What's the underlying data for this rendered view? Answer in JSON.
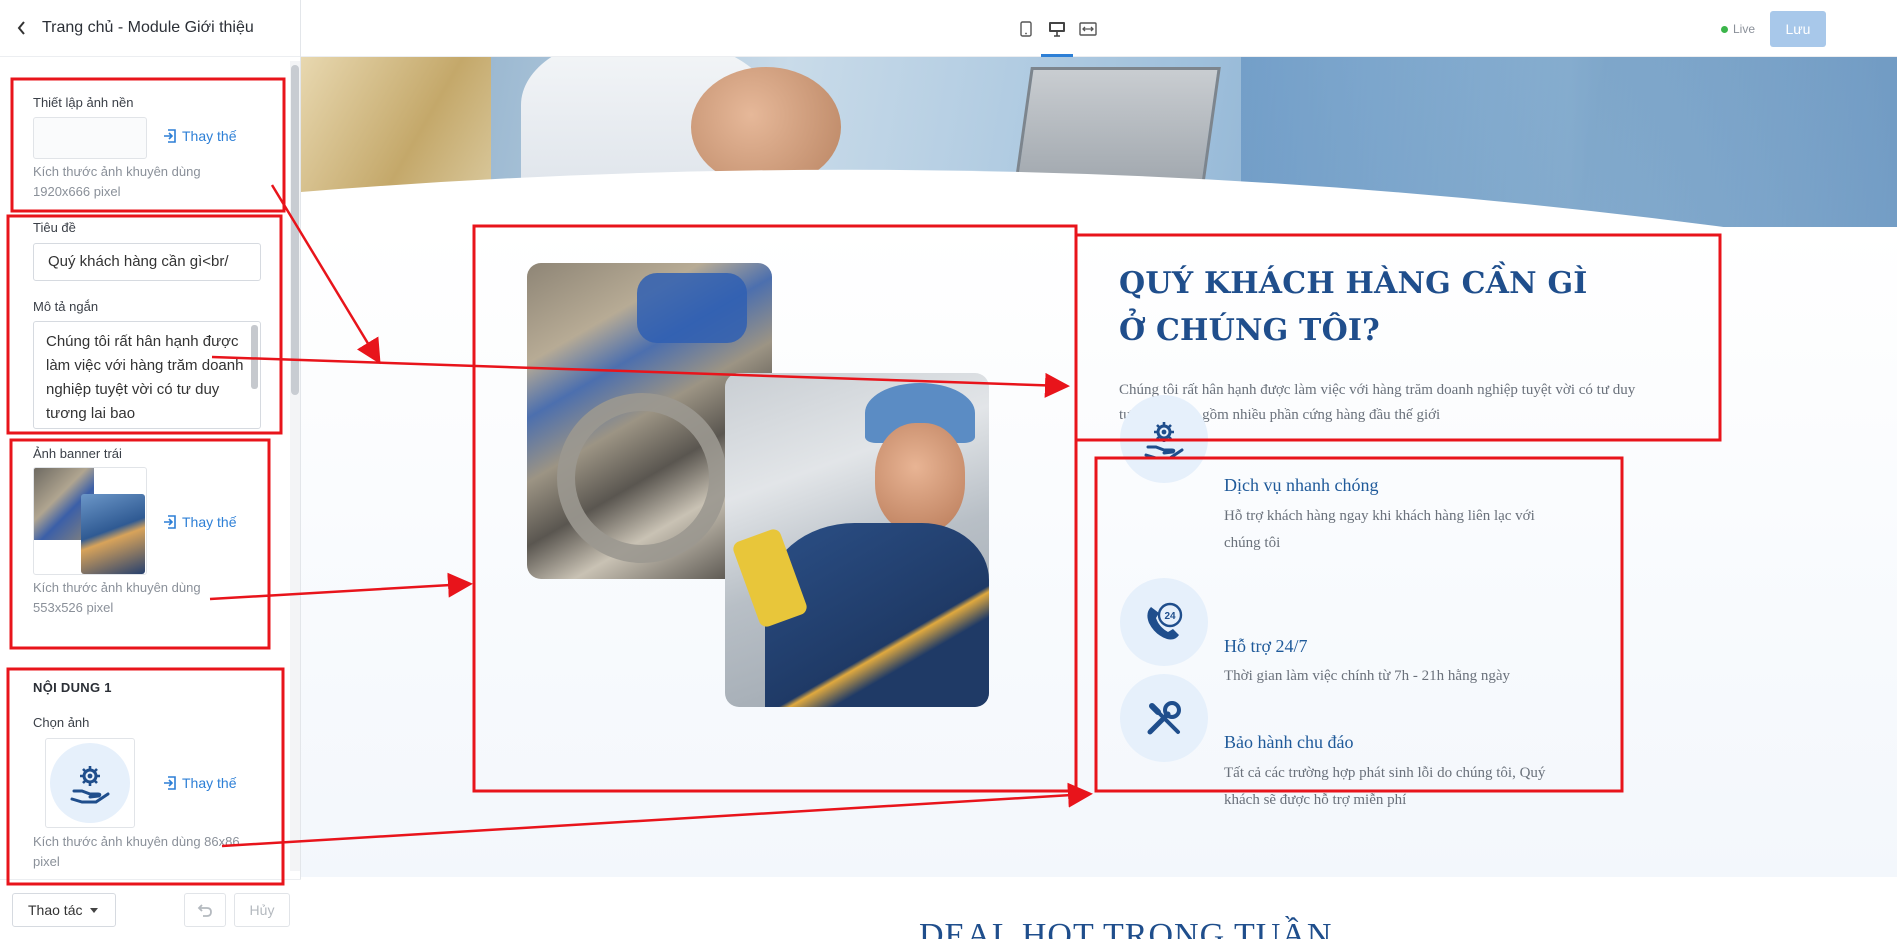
{
  "panel": {
    "title": "Trang chủ - Module Giới thiệu",
    "background": {
      "label": "Thiết lập ảnh nền",
      "replace_label": "Thay thế",
      "hint_line1": "Kích thước ảnh khuyên dùng",
      "hint_line2": "1920x666 pixel"
    },
    "title_field": {
      "label": "Tiêu đề",
      "value": "Quý khách hàng cần gì<br/"
    },
    "short_desc": {
      "label": "Mô tả ngắn",
      "value": "Chúng tôi rất hân hạnh được làm việc với hàng trăm doanh nghiệp tuyệt vời có tư duy tương lai bao"
    },
    "left_banner": {
      "label": "Ảnh banner trái",
      "replace_label": "Thay thế",
      "hint_line1": "Kích thước ảnh khuyên dùng",
      "hint_line2": "553x526 pixel"
    },
    "content1": {
      "section_title": "NỘI DUNG 1",
      "image_label": "Chọn ảnh",
      "replace_label": "Thay thế",
      "hint_line1": "Kích thước ảnh khuyên dùng 86x86",
      "hint_line2": "pixel"
    },
    "footer": {
      "action_label": "Thao tác",
      "cancel_label": "Hủy"
    }
  },
  "topbar": {
    "devices": [
      "mobile-icon",
      "desktop-icon",
      "fullwidth-icon"
    ],
    "active_device": "desktop",
    "live_label": "Live",
    "save_label": "Lưu"
  },
  "preview": {
    "headline_line1": "QUÝ KHÁCH HÀNG CẦN GÌ",
    "headline_line2": "Ở CHÚNG TÔI?",
    "lead": "Chúng tôi rất hân hạnh được làm việc với hàng trăm doanh nghiệp tuyệt vời có tư duy tương lai bao gồm nhiều phần cứng hàng đầu thế giới",
    "services": [
      {
        "title": "Dịch vụ nhanh chóng",
        "desc": "Hỗ trợ khách hàng ngay khi khách hàng liên lạc với chúng tôi",
        "icon": "service-hand-gear-icon"
      },
      {
        "title": "Hỗ trợ 24/7",
        "desc": "Thời gian làm việc chính từ 7h - 21h hằng ngày",
        "icon": "support-24-phone-icon"
      },
      {
        "title": "Bảo hành chu đáo",
        "desc": "Tất cả các trường hợp phát sinh lỗi do chúng tôi, Quý khách sẽ được hỗ trợ miễn phí",
        "icon": "tools-wrench-screwdriver-icon"
      }
    ],
    "next_section_title": "DEAL HOT TRONG TUẦN"
  },
  "colors": {
    "accent": "#2d7fd6",
    "heading": "#1f4e8c",
    "annotation": "#e8141b",
    "save_disabled": "#a8c8ea",
    "live_dot": "#3bb54a"
  }
}
